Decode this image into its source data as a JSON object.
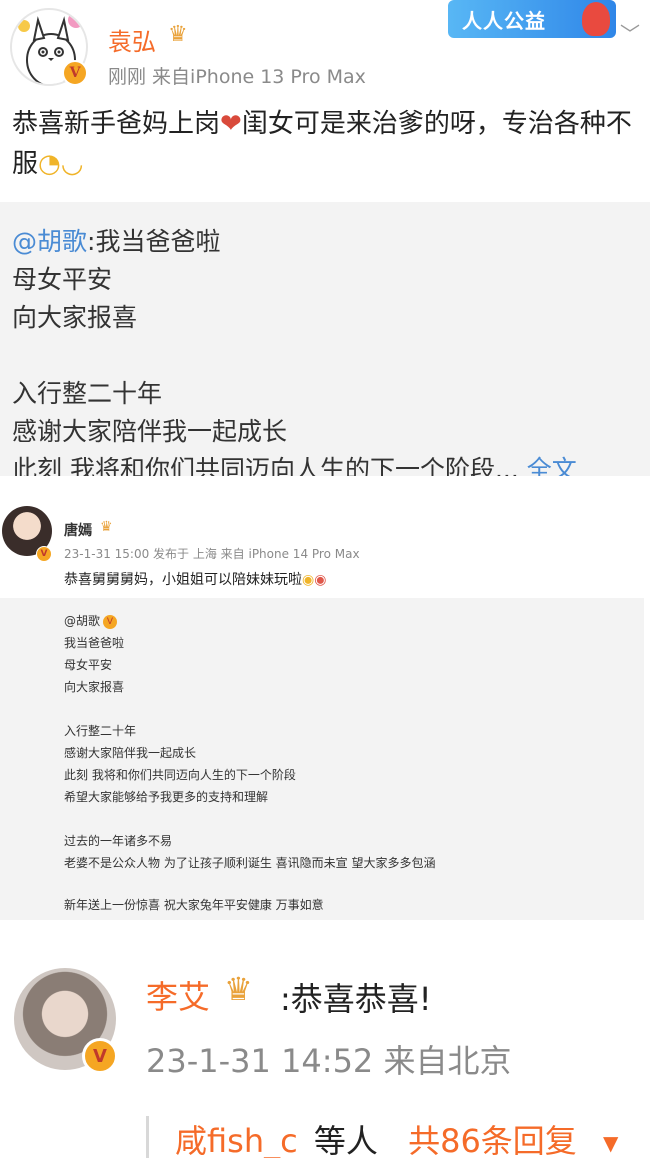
{
  "post1": {
    "username": "袁弘",
    "meta": "刚刚  来自iPhone 13 Pro Max",
    "banner": "人人公益",
    "text_part1": "恭喜新手爸妈上岗",
    "text_part2": "闺女可是来治爹的呀，专治各种不服",
    "repost": {
      "mention": "@胡歌",
      "line1_rest": ":我当爸爸啦",
      "line2": "母女平安",
      "line3": "向大家报喜",
      "line4": "入行整二十年",
      "line5": "感谢大家陪伴我一起成长",
      "line6": "此刻 我将和你们共同迈向人生的下一个阶段...",
      "full_link": "全文"
    }
  },
  "post2": {
    "username": "唐嫣",
    "meta": "23-1-31 15:00  发布于 上海  来自 iPhone 14 Pro Max",
    "text": "恭喜舅舅舅妈，小姐姐可以陪妹妹玩啦",
    "repost": {
      "mention": "@胡歌",
      "lines": [
        "我当爸爸啦",
        "母女平安",
        "向大家报喜",
        "入行整二十年",
        "感谢大家陪伴我一起成长",
        "此刻 我将和你们共同迈向人生的下一个阶段",
        "希望大家能够给予我更多的支持和理解",
        "过去的一年诸多不易",
        "老婆不是公众人物 为了让孩子顺利诞生 喜讯隐而未宣 望大家多多包涵",
        "新年送上一份惊喜 祝大家兔年平安健康 万事如意"
      ]
    }
  },
  "post3": {
    "username": "李艾",
    "text": ":恭喜恭喜!",
    "meta": "23-1-31 14:52  来自北京",
    "reply_user": "咸fish_c",
    "reply_others": "等人",
    "reply_count": "共86条回复"
  },
  "colors": {
    "accent_orange": "#f56b29",
    "link_blue": "#4a8bd4",
    "repost_bg": "#f3f3f3",
    "meta_gray": "#8a8a8a"
  },
  "icons": [
    "totoro-avatar",
    "verified-badge",
    "crown-icon",
    "chevron-down-icon",
    "heart-emoji",
    "grin-emoji",
    "triangle-down-icon"
  ]
}
